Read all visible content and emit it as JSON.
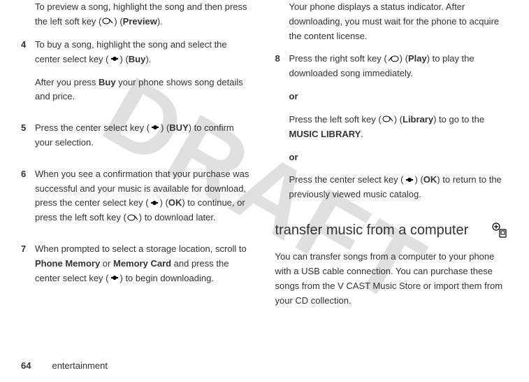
{
  "watermark": "DRAFT",
  "left": {
    "intro": "To preview a song, highlight the song and then press the left soft key (",
    "intro2": ") (",
    "intro_preview": "Preview",
    "intro3": ").",
    "step4_num": "4",
    "step4_a": "To buy a song, highlight the song and select the center select key (",
    "step4_b": ") (",
    "step4_buy": "Buy",
    "step4_c": ").",
    "step4_after_a": "After you press ",
    "step4_after_buy": "Buy",
    "step4_after_b": " your phone shows song details and price.",
    "step5_num": "5",
    "step5_a": "Press the center select key (",
    "step5_b": ") (",
    "step5_buy": "BUY",
    "step5_c": ") to confirm your selection.",
    "step6_num": "6",
    "step6_a": "When you see a confirmation that your purchase was successful and your music is available for download, press the center select key (",
    "step6_b": ") (",
    "step6_ok": "OK",
    "step6_c": ") to continue, or press the left soft key (",
    "step6_d": ") to download later.",
    "step7_num": "7",
    "step7_a": "When prompted to select a storage location, scroll to ",
    "step7_pm": "Phone Memory",
    "step7_or": " or ",
    "step7_mc": "Memory Card",
    "step7_b": " and press the center select key (",
    "step7_c": ") to begin downloading."
  },
  "right": {
    "intro": "Your phone displays a status indicator. After downloading, you must wait for the phone to acquire the content license.",
    "step8_num": "8",
    "step8_a": "Press the right soft key (",
    "step8_b": ") (",
    "step8_play": "Play",
    "step8_c": ") to play the downloaded song immediately.",
    "or1": "or",
    "alt1_a": "Press the left soft key (",
    "alt1_b": ") (",
    "alt1_lib": "Library",
    "alt1_c": ") to go to the ",
    "alt1_ml": "MUSIC LIBRARY",
    "alt1_d": ".",
    "or2": "or",
    "alt2_a": "Press the center select key (",
    "alt2_b": ") (",
    "alt2_ok": "OK",
    "alt2_c": ") to return to the previously viewed music catalog.",
    "heading": "transfer music from a computer",
    "para": "You can transfer songs from a computer to your phone with a USB cable connection. You can purchase these songs from the V CAST Music Store or import them from your CD collection."
  },
  "footer": {
    "page": "64",
    "section": "entertainment"
  }
}
